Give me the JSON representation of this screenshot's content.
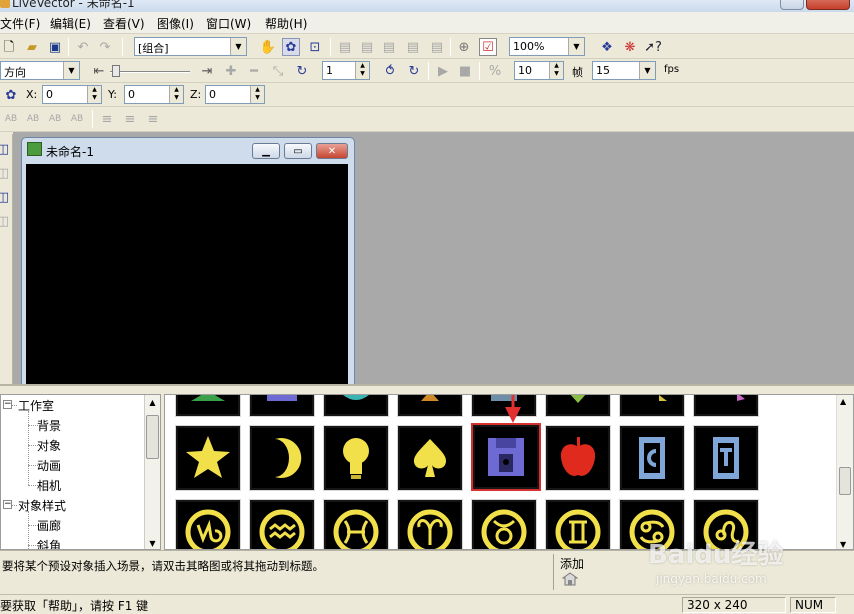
{
  "window": {
    "title": "LiveVector - 未命名-1"
  },
  "menu": [
    {
      "label": "文件(F)"
    },
    {
      "label": "编辑(E)"
    },
    {
      "label": "查看(V)"
    },
    {
      "label": "图像(I)"
    },
    {
      "label": "窗口(W)"
    },
    {
      "label": "帮助(H)"
    }
  ],
  "toolbar1": {
    "group_select": "[组合]",
    "zoom": "100%"
  },
  "toolbar2": {
    "direction": "方向",
    "step": "1",
    "frame_value": "10",
    "frame_label": "帧",
    "fps_value": "15",
    "fps_label": "fps"
  },
  "toolbar3": {
    "x_label": "X:",
    "x_value": "0",
    "y_label": "Y:",
    "y_value": "0",
    "z_label": "Z:",
    "z_value": "0"
  },
  "toolbar4": {
    "text_icons": [
      "AB",
      "AB",
      "AB",
      "AB"
    ]
  },
  "document": {
    "title": "未命名-1"
  },
  "tree": {
    "studio": "工作室",
    "studio_items": [
      "背景",
      "对象",
      "动画",
      "相机"
    ],
    "object_style": "对象样式",
    "style_items": [
      "画廊",
      "斜角"
    ]
  },
  "gallery": {
    "row2": [
      "star-icon",
      "moon-icon",
      "lightbulb-icon",
      "spade-icon",
      "floppy-disk-icon",
      "apple-icon",
      "blue-frame-c-icon",
      "blue-frame-t-icon"
    ],
    "row3": [
      "capricorn-icon",
      "aquarius-icon",
      "pisces-icon",
      "aries-icon",
      "taurus-icon",
      "gemini-icon",
      "cancer-icon",
      "leo-icon"
    ]
  },
  "hint": {
    "text": "要将某个预设对象插入场景，请双击其略图或将其拖动到标题。",
    "add_label": "添加"
  },
  "status": {
    "help_text": "要获取「帮助」，请按 F1 键",
    "size": "320 x 240",
    "num": "NUM"
  },
  "watermark": {
    "brand": "Baidu经验",
    "url": "jingyan.baidu.com"
  },
  "colors": {
    "accent_red": "#d73030",
    "gold": "#f2e04a",
    "canvas_bg": "#000000",
    "workspace_bg": "#a9a9a9"
  }
}
